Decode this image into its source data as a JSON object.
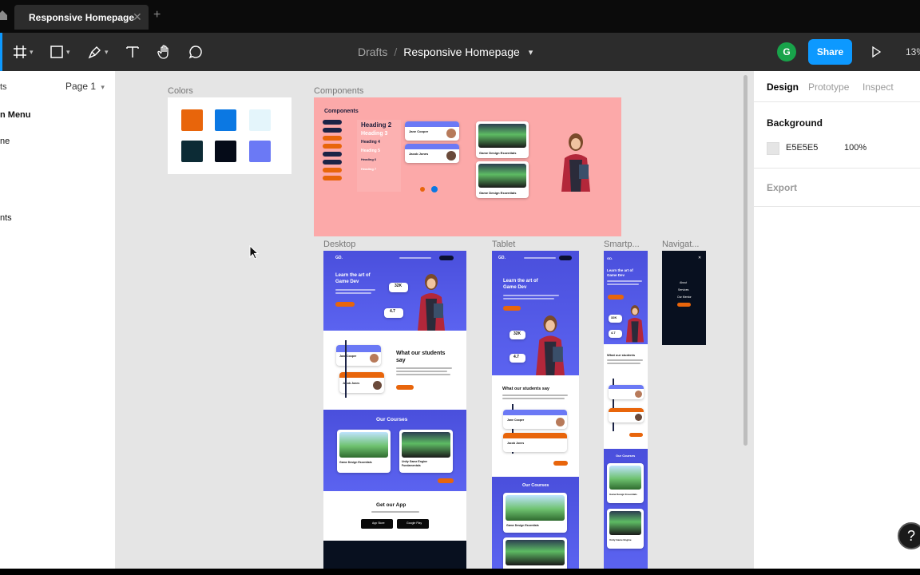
{
  "tabs": {
    "active_label": "Responsive Homepage",
    "close_glyph": "✕",
    "new_tab_glyph": "+"
  },
  "toolbar": {
    "tools": [
      "frame-tool",
      "shape-tool",
      "pen-tool",
      "text-tool",
      "hand-tool",
      "comment-tool"
    ],
    "breadcrumb_parent": "Drafts",
    "breadcrumb_sep": "/",
    "file_name": "Responsive Homepage",
    "avatar_initial": "G",
    "share_label": "Share",
    "zoom": "13%"
  },
  "left_panel": {
    "page_select": "Page 1",
    "layers": [
      "ts",
      "n Menu",
      "ne",
      "nts"
    ]
  },
  "right_panel": {
    "tabs": [
      "Design",
      "Prototype",
      "Inspect"
    ],
    "background_heading": "Background",
    "background_hex": "E5E5E5",
    "background_opacity": "100%",
    "export_heading": "Export"
  },
  "canvas": {
    "frames": {
      "colors": "Colors",
      "components": "Components",
      "desktop": "Desktop",
      "tablet": "Tablet",
      "smartphone": "Smartp...",
      "navigation": "Navigat..."
    },
    "swatches": [
      "#e8650b",
      "#0b78e3",
      "#e4f5fb",
      "#0c2b35",
      "#050b18",
      "#6b79f5"
    ],
    "accent": "#e8650b",
    "components_bg": "#fca9a9",
    "components_title": "Components",
    "headings": [
      "Heading 2",
      "Heading 3",
      "Heading 4",
      "Heading 5",
      "Heading 6",
      "Heading 7"
    ],
    "hero_title_line1": "Learn the art of",
    "hero_title_line2": "Game Dev",
    "stat_students": "32K",
    "stat_rating": "4.7",
    "testimonials_heading_line1": "What our students",
    "testimonials_heading_line2": "say",
    "tablet_testimonials_heading": "What our students say",
    "courses_heading": "Our Courses",
    "course1": "Game Design Essentials",
    "course2_line1": "Unity Game Engine",
    "course2_line2": "Fundamentals",
    "app_heading": "Get our App",
    "app_store": "App Store",
    "google_play": "Google Play",
    "person1": "Jane Cooper",
    "person2": "Jacob Jones",
    "logo": "GD.",
    "nav_items": [
      "About",
      "Services",
      "Our Mentor"
    ],
    "close_glyph": "✕"
  },
  "help_glyph": "?"
}
